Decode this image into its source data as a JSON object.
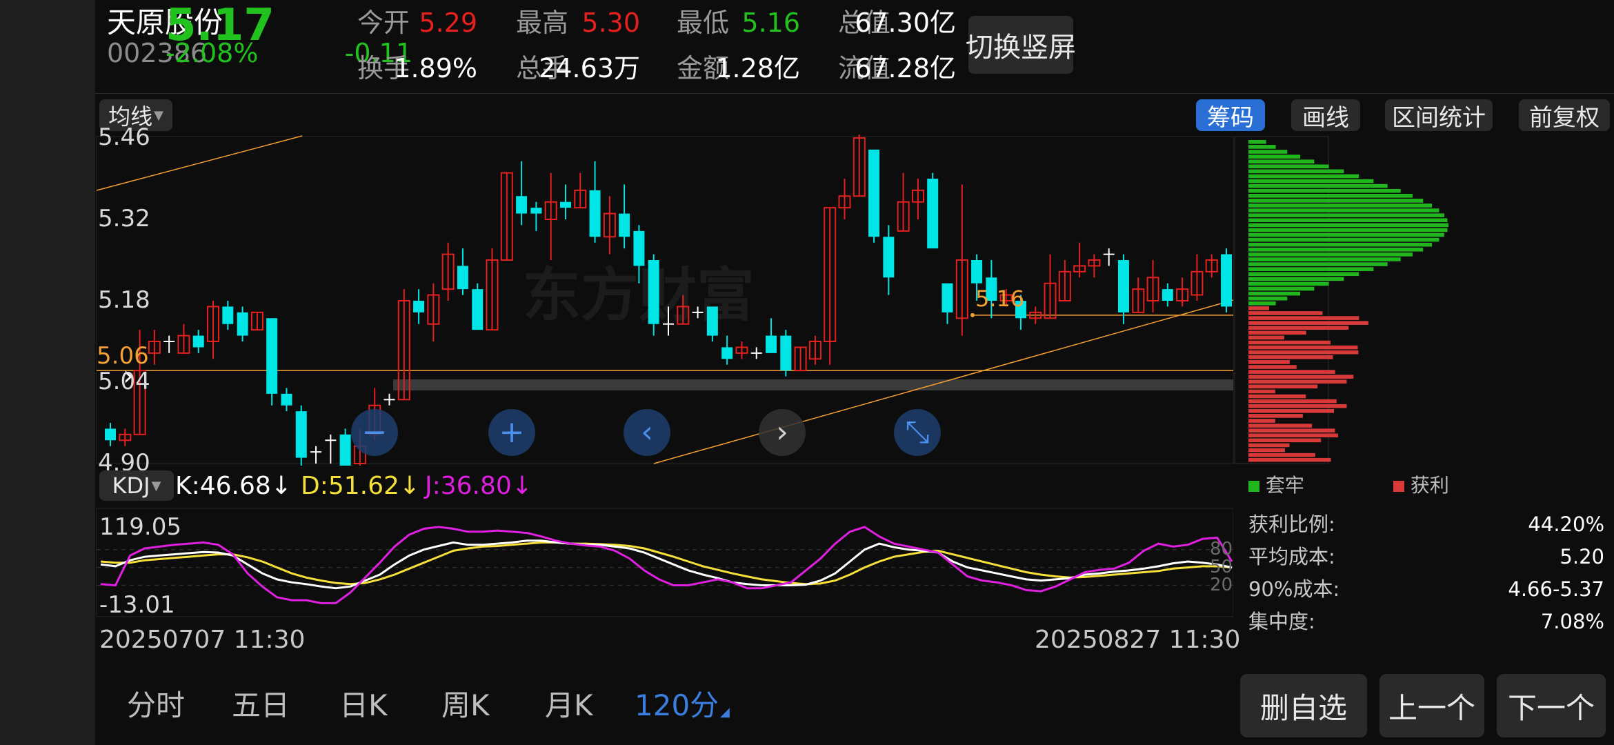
{
  "header": {
    "stock_name": "天原股份",
    "price": "5.17",
    "code": "002386",
    "change_pct": "-2.08%",
    "change_amt": "-0.11",
    "stats": [
      {
        "label": "今开",
        "value": "5.29",
        "color": "#e5201e"
      },
      {
        "label": "最高",
        "value": "5.30",
        "color": "#e5201e"
      },
      {
        "label": "最低",
        "value": "5.16",
        "color": "#22c21e"
      },
      {
        "label": "总值",
        "value": "67.30亿",
        "color": "#ffffff"
      },
      {
        "label": "换手",
        "value": "1.89%",
        "color": "#ffffff"
      },
      {
        "label": "总手",
        "value": "24.63万",
        "color": "#ffffff"
      },
      {
        "label": "金额",
        "value": "1.28亿",
        "color": "#ffffff"
      },
      {
        "label": "流值",
        "value": "67.28亿",
        "color": "#ffffff"
      }
    ],
    "switch_button": "切换竖屏"
  },
  "toolbar": {
    "ma_dropdown": "均线",
    "chips_button": "筹码",
    "draw_button": "画线",
    "range_stats_button": "区间统计",
    "adjust_button": "前复权"
  },
  "main_chart": {
    "y_labels": [
      "5.46",
      "5.32",
      "5.18",
      "5.04",
      "4.90"
    ],
    "marker_left": "5.06",
    "marker_low": "5.16",
    "watermark": "东方财富"
  },
  "chips": {
    "legend_trapped": "套牢",
    "legend_profit": "获利",
    "stats": [
      {
        "label": "获利比例:",
        "value": "44.20%"
      },
      {
        "label": "平均成本:",
        "value": "5.20"
      },
      {
        "label": "90%成本:",
        "value": "4.66-5.37"
      },
      {
        "label": "集中度:",
        "value": "7.08%"
      }
    ]
  },
  "kdj": {
    "dropdown": "KDJ",
    "k_label": "K:46.68",
    "d_label": "D:51.62",
    "j_label": "J:36.80",
    "arrow": "↓",
    "y_top": "119.05",
    "y_bottom": "-13.01",
    "right_labels": [
      "80",
      "50",
      "20"
    ]
  },
  "dates": {
    "start": "20250707 11:30",
    "end": "20250827 11:30"
  },
  "period_tabs": [
    "分时",
    "五日",
    "日K",
    "周K",
    "月K",
    "120分"
  ],
  "active_tab": "120分",
  "bottom_buttons": {
    "remove": "删自选",
    "prev": "上一个",
    "next": "下一个"
  },
  "colors": {
    "up": "#e5201e",
    "down": "#00e5e5",
    "k_line": "#ffffff",
    "d_line": "#f5e03a",
    "j_line": "#e020e0",
    "accent_blue": "#2a6fd6",
    "marker_orange": "#f5a033"
  },
  "chart_data": {
    "type": "candlestick",
    "x_range": [
      "20250707 11:30",
      "20250827 11:30"
    ],
    "ylim": [
      4.9,
      5.46
    ],
    "candles": [
      {
        "o": 4.96,
        "c": 4.94,
        "h": 4.97,
        "l": 4.93
      },
      {
        "o": 4.94,
        "c": 4.95,
        "h": 4.96,
        "l": 4.93
      },
      {
        "o": 4.95,
        "c": 5.06,
        "h": 5.13,
        "l": 4.95
      },
      {
        "o": 5.09,
        "c": 5.11,
        "h": 5.13,
        "l": 5.07
      },
      {
        "o": 5.11,
        "c": 5.11,
        "h": 5.12,
        "l": 5.09
      },
      {
        "o": 5.09,
        "c": 5.12,
        "h": 5.14,
        "l": 5.09
      },
      {
        "o": 5.12,
        "c": 5.1,
        "h": 5.13,
        "l": 5.09
      },
      {
        "o": 5.11,
        "c": 5.17,
        "h": 5.18,
        "l": 5.08
      },
      {
        "o": 5.17,
        "c": 5.14,
        "h": 5.18,
        "l": 5.13
      },
      {
        "o": 5.16,
        "c": 5.12,
        "h": 5.17,
        "l": 5.11
      },
      {
        "o": 5.13,
        "c": 5.16,
        "h": 5.16,
        "l": 5.13
      },
      {
        "o": 5.15,
        "c": 5.02,
        "h": 5.15,
        "l": 5.0
      },
      {
        "o": 5.02,
        "c": 5.0,
        "h": 5.03,
        "l": 4.99
      },
      {
        "o": 4.99,
        "c": 4.91,
        "h": 5.0,
        "l": 4.88
      },
      {
        "o": 4.92,
        "c": 4.92,
        "h": 4.93,
        "l": 4.9
      },
      {
        "o": 4.94,
        "c": 4.94,
        "h": 4.95,
        "l": 4.9
      },
      {
        "o": 4.95,
        "c": 4.88,
        "h": 4.96,
        "l": 4.88
      },
      {
        "o": 4.9,
        "c": 4.93,
        "h": 4.96,
        "l": 4.89
      },
      {
        "o": 4.95,
        "c": 5.0,
        "h": 5.03,
        "l": 4.94
      },
      {
        "o": 5.01,
        "c": 5.01,
        "h": 5.02,
        "l": 5.0
      },
      {
        "o": 5.01,
        "c": 5.18,
        "h": 5.2,
        "l": 5.01
      },
      {
        "o": 5.18,
        "c": 5.16,
        "h": 5.2,
        "l": 5.14
      },
      {
        "o": 5.14,
        "c": 5.19,
        "h": 5.21,
        "l": 5.11
      },
      {
        "o": 5.2,
        "c": 5.26,
        "h": 5.28,
        "l": 5.18
      },
      {
        "o": 5.24,
        "c": 5.2,
        "h": 5.27,
        "l": 5.19
      },
      {
        "o": 5.2,
        "c": 5.13,
        "h": 5.21,
        "l": 5.13
      },
      {
        "o": 5.13,
        "c": 5.25,
        "h": 5.27,
        "l": 5.13
      },
      {
        "o": 5.25,
        "c": 5.4,
        "h": 5.4,
        "l": 5.25
      },
      {
        "o": 5.36,
        "c": 5.33,
        "h": 5.42,
        "l": 5.31
      },
      {
        "o": 5.34,
        "c": 5.33,
        "h": 5.35,
        "l": 5.3
      },
      {
        "o": 5.32,
        "c": 5.35,
        "h": 5.4,
        "l": 5.25
      },
      {
        "o": 5.35,
        "c": 5.34,
        "h": 5.38,
        "l": 5.32
      },
      {
        "o": 5.34,
        "c": 5.37,
        "h": 5.4,
        "l": 5.34
      },
      {
        "o": 5.37,
        "c": 5.29,
        "h": 5.42,
        "l": 5.28
      },
      {
        "o": 5.29,
        "c": 5.33,
        "h": 5.36,
        "l": 5.26
      },
      {
        "o": 5.33,
        "c": 5.29,
        "h": 5.38,
        "l": 5.27
      },
      {
        "o": 5.3,
        "c": 5.24,
        "h": 5.31,
        "l": 5.21
      },
      {
        "o": 5.25,
        "c": 5.14,
        "h": 5.26,
        "l": 5.12
      },
      {
        "o": 5.14,
        "c": 5.14,
        "h": 5.17,
        "l": 5.12
      },
      {
        "o": 5.14,
        "c": 5.17,
        "h": 5.19,
        "l": 5.14
      },
      {
        "o": 5.16,
        "c": 5.16,
        "h": 5.17,
        "l": 5.15
      },
      {
        "o": 5.17,
        "c": 5.12,
        "h": 5.17,
        "l": 5.11
      },
      {
        "o": 5.1,
        "c": 5.08,
        "h": 5.12,
        "l": 5.07
      },
      {
        "o": 5.09,
        "c": 5.1,
        "h": 5.11,
        "l": 5.08
      },
      {
        "o": 5.09,
        "c": 5.09,
        "h": 5.1,
        "l": 5.08
      },
      {
        "o": 5.12,
        "c": 5.09,
        "h": 5.15,
        "l": 5.09
      },
      {
        "o": 5.12,
        "c": 5.06,
        "h": 5.13,
        "l": 5.05
      },
      {
        "o": 5.06,
        "c": 5.1,
        "h": 5.1,
        "l": 5.06
      },
      {
        "o": 5.08,
        "c": 5.11,
        "h": 5.12,
        "l": 5.07
      },
      {
        "o": 5.11,
        "c": 5.34,
        "h": 5.34,
        "l": 5.07
      },
      {
        "o": 5.34,
        "c": 5.36,
        "h": 5.39,
        "l": 5.32
      },
      {
        "o": 5.36,
        "c": 5.46,
        "h": 5.49,
        "l": 5.36
      },
      {
        "o": 5.44,
        "c": 5.29,
        "h": 5.44,
        "l": 5.28
      },
      {
        "o": 5.29,
        "c": 5.22,
        "h": 5.31,
        "l": 5.19
      },
      {
        "o": 5.3,
        "c": 5.35,
        "h": 5.4,
        "l": 5.3
      },
      {
        "o": 5.35,
        "c": 5.37,
        "h": 5.39,
        "l": 5.32
      },
      {
        "o": 5.39,
        "c": 5.27,
        "h": 5.4,
        "l": 5.27
      },
      {
        "o": 5.21,
        "c": 5.16,
        "h": 5.21,
        "l": 5.14
      },
      {
        "o": 5.15,
        "c": 5.25,
        "h": 5.38,
        "l": 5.12
      },
      {
        "o": 5.25,
        "c": 5.21,
        "h": 5.26,
        "l": 5.18
      },
      {
        "o": 5.22,
        "c": 5.18,
        "h": 5.25,
        "l": 5.15
      },
      {
        "o": 5.18,
        "c": 5.19,
        "h": 5.2,
        "l": 5.17
      },
      {
        "o": 5.18,
        "c": 5.15,
        "h": 5.19,
        "l": 5.13
      },
      {
        "o": 5.15,
        "c": 5.16,
        "h": 5.17,
        "l": 5.14
      },
      {
        "o": 5.15,
        "c": 5.21,
        "h": 5.26,
        "l": 5.15
      },
      {
        "o": 5.18,
        "c": 5.23,
        "h": 5.25,
        "l": 5.18
      },
      {
        "o": 5.23,
        "c": 5.24,
        "h": 5.28,
        "l": 5.22
      },
      {
        "o": 5.24,
        "c": 5.25,
        "h": 5.26,
        "l": 5.22
      },
      {
        "o": 5.26,
        "c": 5.26,
        "h": 5.27,
        "l": 5.24
      },
      {
        "o": 5.25,
        "c": 5.16,
        "h": 5.26,
        "l": 5.14
      },
      {
        "o": 5.16,
        "c": 5.2,
        "h": 5.22,
        "l": 5.16
      },
      {
        "o": 5.18,
        "c": 5.22,
        "h": 5.25,
        "l": 5.16
      },
      {
        "o": 5.2,
        "c": 5.18,
        "h": 5.21,
        "l": 5.17
      },
      {
        "o": 5.18,
        "c": 5.2,
        "h": 5.22,
        "l": 5.17
      },
      {
        "o": 5.19,
        "c": 5.23,
        "h": 5.26,
        "l": 5.18
      },
      {
        "o": 5.23,
        "c": 5.25,
        "h": 5.26,
        "l": 5.22
      },
      {
        "o": 5.26,
        "c": 5.17,
        "h": 5.27,
        "l": 5.16
      }
    ],
    "kdj": {
      "ylim": [
        -13.01,
        119.05
      ],
      "K": [
        55,
        52,
        62,
        68,
        70,
        72,
        74,
        76,
        75,
        70,
        55,
        40,
        30,
        25,
        22,
        18,
        15,
        18,
        28,
        38,
        55,
        70,
        80,
        86,
        92,
        88,
        88,
        90,
        92,
        95,
        95,
        92,
        90,
        88,
        88,
        85,
        82,
        75,
        65,
        55,
        45,
        38,
        32,
        25,
        22,
        20,
        20,
        20,
        21,
        28,
        40,
        60,
        80,
        90,
        84,
        80,
        78,
        75,
        60,
        50,
        45,
        40,
        35,
        30,
        28,
        30,
        32,
        38,
        40,
        43,
        45,
        48,
        52,
        57,
        60,
        58,
        55,
        50
      ],
      "D": [
        60,
        58,
        58,
        62,
        64,
        66,
        68,
        70,
        72,
        72,
        67,
        60,
        50,
        40,
        33,
        28,
        24,
        22,
        24,
        30,
        38,
        48,
        58,
        68,
        78,
        82,
        85,
        86,
        88,
        90,
        92,
        92,
        90,
        90,
        89,
        88,
        86,
        82,
        75,
        68,
        60,
        52,
        46,
        40,
        35,
        30,
        27,
        24,
        22,
        23,
        28,
        38,
        50,
        60,
        68,
        72,
        76,
        78,
        72,
        66,
        60,
        54,
        48,
        42,
        38,
        35,
        33,
        34,
        36,
        38,
        40,
        42,
        44,
        48,
        50,
        52,
        52,
        50
      ],
      "J": [
        22,
        20,
        70,
        82,
        85,
        88,
        90,
        92,
        88,
        72,
        40,
        18,
        0,
        -5,
        -5,
        -10,
        -10,
        8,
        33,
        58,
        85,
        105,
        115,
        118,
        115,
        110,
        110,
        112,
        110,
        108,
        102,
        95,
        90,
        87,
        85,
        78,
        65,
        45,
        30,
        20,
        20,
        25,
        30,
        25,
        15,
        15,
        20,
        25,
        45,
        65,
        90,
        110,
        118,
        102,
        90,
        85,
        80,
        75,
        55,
        35,
        28,
        25,
        20,
        12,
        10,
        18,
        30,
        42,
        46,
        48,
        58,
        78,
        90,
        85,
        88,
        98,
        100,
        60
      ]
    },
    "chips_profile": {
      "trapped_count": 34,
      "profit_count": 32
    }
  }
}
